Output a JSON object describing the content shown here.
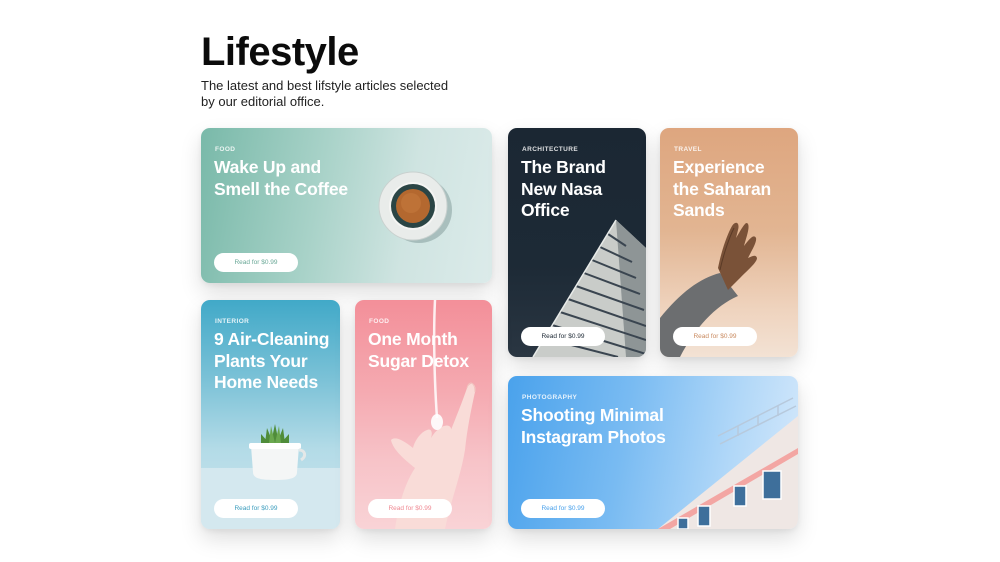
{
  "page": {
    "title": "Lifestyle",
    "subtitle": "The latest and best lifstyle articles selected by our editorial office."
  },
  "cards": [
    {
      "category": "FOOD",
      "title": "Wake Up and Smell the Coffee",
      "button": "Read for $0.99",
      "image": "coffee-cup-icon"
    },
    {
      "category": "ARCHITECTURE",
      "title": "The Brand New Nasa Office",
      "button": "Read for $0.99",
      "image": "building-icon"
    },
    {
      "category": "TRAVEL",
      "title": "Experience the Saharan Sands",
      "button": "Read for $0.99",
      "image": "hand-icon"
    },
    {
      "category": "INTERIOR",
      "title": "9 Air-Cleaning Plants Your Home Needs",
      "button": "Read for $0.99",
      "image": "succulent-pot-icon"
    },
    {
      "category": "FOOD",
      "title": "One Month Sugar Detox",
      "button": "Read for $0.99",
      "image": "hand-pour-icon"
    },
    {
      "category": "PHOTOGRAPHY",
      "title": "Shooting Minimal Instagram Photos",
      "button": "Read for $0.99",
      "image": "building-facade-icon"
    }
  ],
  "colors": {
    "coffee": "#79b9a9",
    "nasa": "#1b2733",
    "sahara": "#dea67f",
    "plants": "#41a9c8",
    "sugar": "#f38f99",
    "photo": "#4aa2ec"
  }
}
